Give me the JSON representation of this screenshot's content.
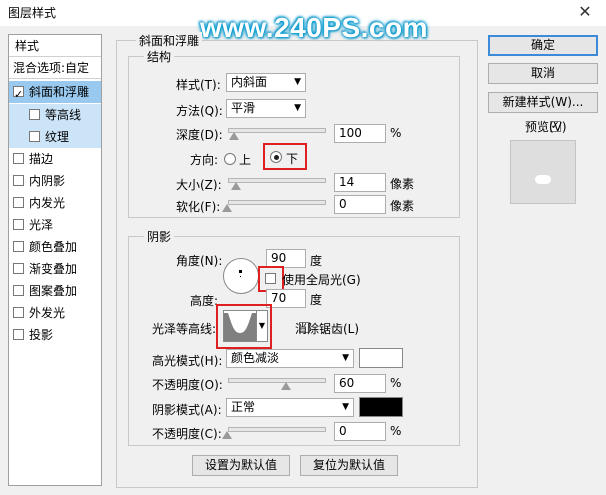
{
  "window": {
    "title": "图层样式",
    "close_glyph": "✕"
  },
  "watermark": "www.240PS.com",
  "sidebar": {
    "header": "样式",
    "blend": "混合选项:自定",
    "items": [
      {
        "label": "斜面和浮雕",
        "checked": true
      },
      {
        "label": "等高线",
        "checked": false
      },
      {
        "label": "纹理",
        "checked": false
      },
      {
        "label": "描边",
        "checked": false
      },
      {
        "label": "内阴影",
        "checked": false
      },
      {
        "label": "内发光",
        "checked": false
      },
      {
        "label": "光泽",
        "checked": false
      },
      {
        "label": "颜色叠加",
        "checked": false
      },
      {
        "label": "渐变叠加",
        "checked": false
      },
      {
        "label": "图案叠加",
        "checked": false
      },
      {
        "label": "外发光",
        "checked": false
      },
      {
        "label": "投影",
        "checked": false
      }
    ]
  },
  "bevel": {
    "title": "斜面和浮雕",
    "structure": {
      "title": "结构",
      "style_label": "样式(T):",
      "style_value": "内斜面",
      "technique_label": "方法(Q):",
      "technique_value": "平滑",
      "depth_label": "深度(D):",
      "depth_value": "100",
      "depth_unit": "%",
      "direction_label": "方向:",
      "dir_up": "上",
      "dir_down": "下",
      "size_label": "大小(Z):",
      "size_value": "14",
      "size_unit": "像素",
      "soften_label": "软化(F):",
      "soften_value": "0",
      "soften_unit": "像素"
    },
    "shading": {
      "title": "阴影",
      "angle_label": "角度(N):",
      "angle_value": "90",
      "angle_unit": "度",
      "global_light_label": "使用全局光(G)",
      "altitude_label": "高度:",
      "altitude_value": "70",
      "altitude_unit": "度",
      "gloss_contour_label": "光泽等高线:",
      "antialias_label": "消除锯齿(L)",
      "highlight_mode_label": "高光模式(H):",
      "highlight_mode_value": "颜色减淡",
      "highlight_color": "#ffffff",
      "highlight_opacity_label": "不透明度(O):",
      "highlight_opacity_value": "60",
      "highlight_opacity_unit": "%",
      "shadow_mode_label": "阴影模式(A):",
      "shadow_mode_value": "正常",
      "shadow_color": "#000000",
      "shadow_opacity_label": "不透明度(C):",
      "shadow_opacity_value": "0",
      "shadow_opacity_unit": "%"
    },
    "make_default": "设置为默认值",
    "reset_default": "复位为默认值"
  },
  "actions": {
    "ok": "确定",
    "cancel": "取消",
    "new_style": "新建样式(W)...",
    "preview_label": "预览(V)"
  },
  "dropdown_arrow": "▼"
}
